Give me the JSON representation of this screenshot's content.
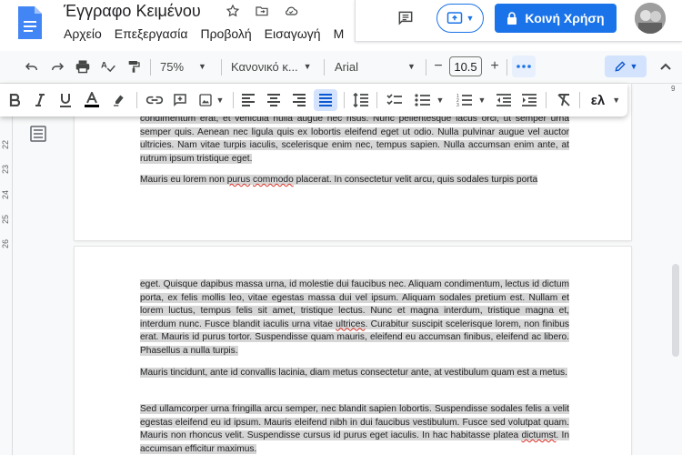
{
  "app": {
    "doc_title": "Έγγραφο Κειμένου",
    "menu": [
      "Αρχείο",
      "Επεξεργασία",
      "Προβολή",
      "Εισαγωγή",
      "Μ"
    ],
    "share_label": "Κοινή Χρήση",
    "accent": "#1a73e8"
  },
  "toolbar": {
    "zoom": "75%",
    "style": "Κανονικό κ...",
    "font": "Arial",
    "font_size": "10.5",
    "minus": "−",
    "plus": "+",
    "input_tools": "ελ"
  },
  "ruler": {
    "marks": [
      "22",
      "23",
      "24",
      "25",
      "26"
    ],
    "right_mark": "9"
  },
  "page1": {
    "p1": "condimentum erat, et vehicula nulla augue nec risus. Nunc pellentesque lacus orci, ut semper urna semper quis. Aenean nec ligula quis ex lobortis eleifend eget ut odio. Nulla pulvinar augue vel auctor ultricies. Nam vitae turpis iaculis, scelerisque enim nec, tempus sapien. Nulla accumsan enim ante, at rutrum ipsum tristique eget.",
    "p2_a": "Mauris eu lorem non ",
    "p2_sq1": "purus",
    "p2_b": " ",
    "p2_sq2": "commodo",
    "p2_c": " placerat. In consectetur velit arcu, quis sodales turpis porta"
  },
  "page2": {
    "p1_a": "eget. Quisque dapibus massa urna, id molestie dui faucibus nec. Aliquam condimentum, lectus id dictum porta, ex felis mollis leo, vitae egestas massa dui vel ipsum. Aliquam sodales pretium est. Nullam et lorem luctus, tempus felis sit amet, tristique lectus. Nunc et magna interdum, tristique magna et, interdum nunc. Fusce blandit iaculis urna vitae ",
    "p1_sq": "ultrices",
    "p1_b": ". Curabitur suscipit scelerisque lorem, non finibus erat. Mauris id purus tortor. Suspendisse quam mauris, eleifend eu accumsan finibus, eleifend ac libero. Phasellus a nulla turpis.",
    "p2": "Mauris tincidunt, ante id convallis lacinia, diam metus consectetur ante, at vestibulum quam est a metus.",
    "p3_a": "Sed ullamcorper urna fringilla arcu semper, nec blandit sapien lobortis. Suspendisse sodales felis a velit egestas eleifend eu id ipsum. Mauris eleifend nibh in dui faucibus vestibulum. Fusce sed volutpat quam. Mauris non rhoncus velit. Suspendisse cursus id purus eget iaculis. In hac habitasse platea ",
    "p3_sq": "dictumst",
    "p3_b": ". In accumsan efficitur maximus."
  }
}
